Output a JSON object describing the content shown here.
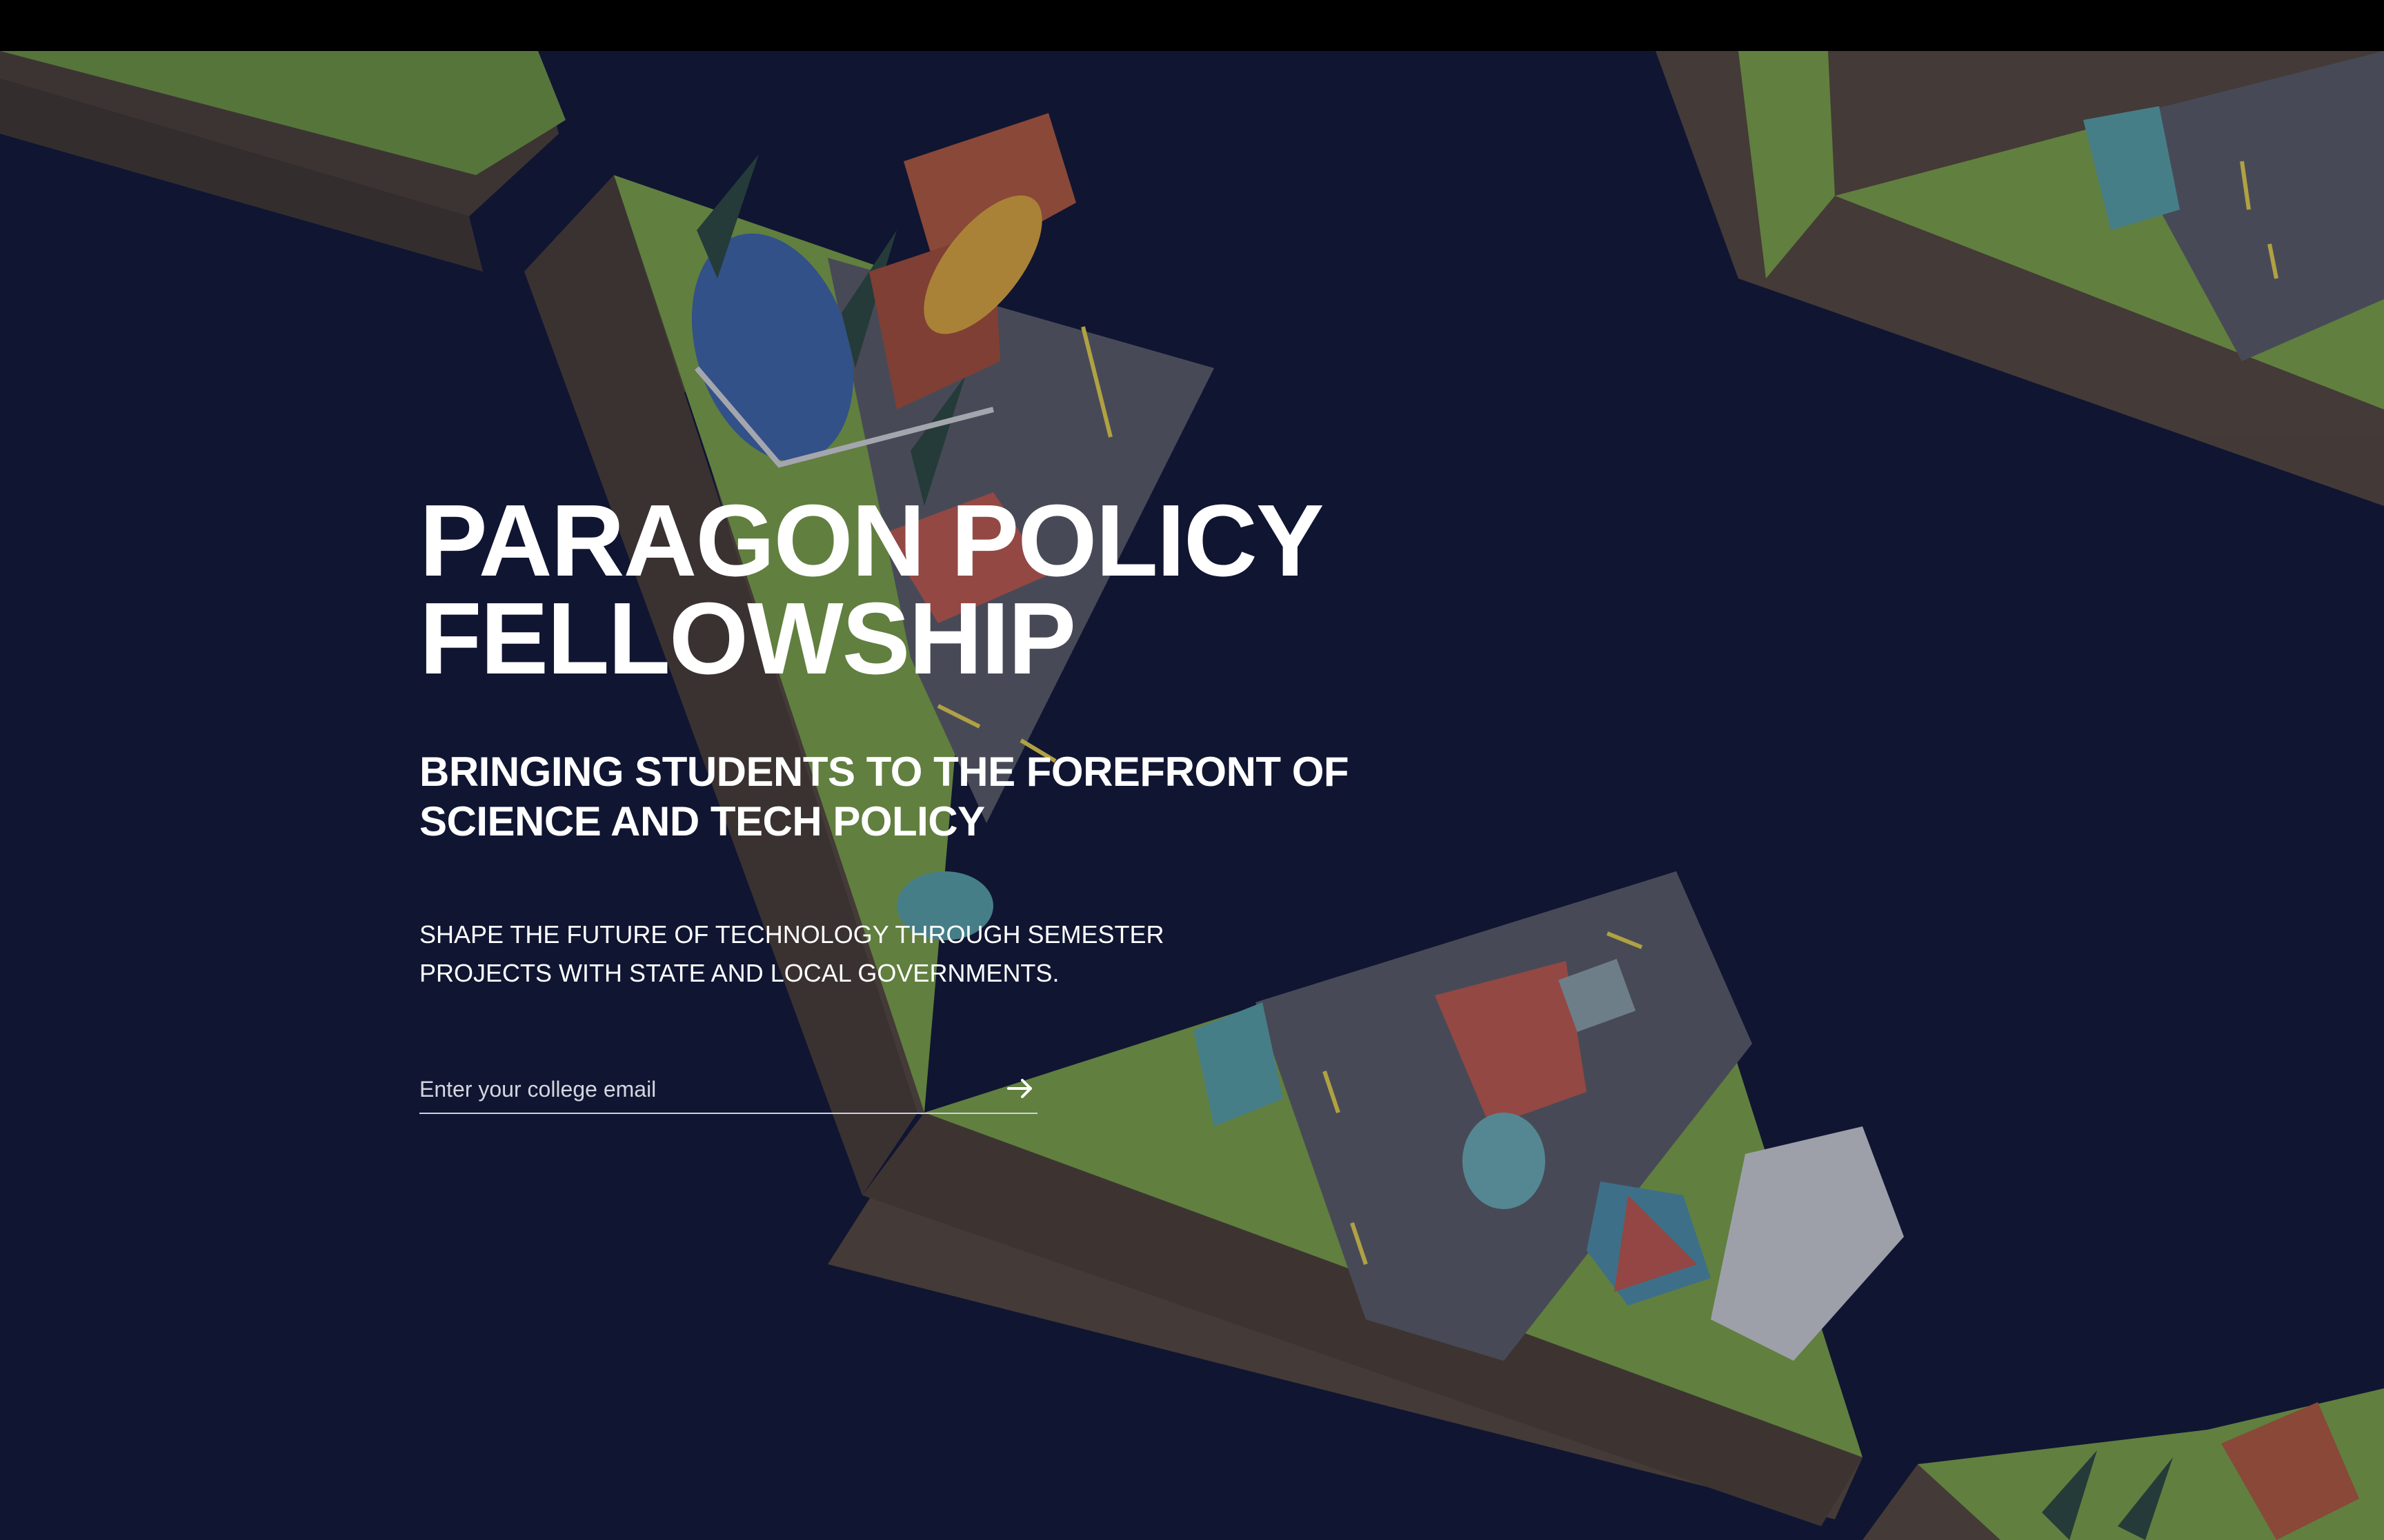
{
  "hero": {
    "title_line1": "PARAGON POLICY",
    "title_line2": "FELLOWSHIP",
    "subtitle_line1": "BRINGING STUDENTS TO THE FOREFRONT OF",
    "subtitle_line2": "SCIENCE AND TECH POLICY",
    "description_line1": "SHAPE THE FUTURE OF TECHNOLOGY THROUGH SEMESTER",
    "description_line2": "PROJECTS WITH STATE AND LOCAL GOVERNMENTS."
  },
  "signup": {
    "email_placeholder": "Enter your college email",
    "submit_icon": "arrow-right-icon"
  },
  "colors": {
    "background": "#111533",
    "topbar": "#000000",
    "text": "#ffffff",
    "grass": "#8fb84a",
    "soil": "#5b4a3a",
    "road": "#5c5f63",
    "lane_marking": "#e8d34a"
  }
}
